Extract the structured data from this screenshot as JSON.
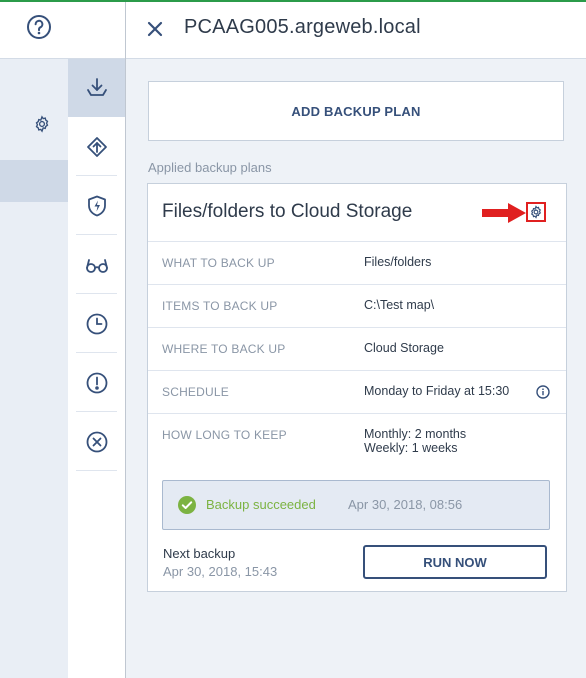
{
  "window": {
    "title": "PCAAG005.argeweb.local"
  },
  "left_strip": {
    "icons": {
      "help": "question-circle-icon",
      "account": "user-circle-icon",
      "settings": "gear-icon"
    }
  },
  "rail": {
    "items": [
      {
        "name": "backup",
        "icon": "download-icon",
        "active": true
      },
      {
        "name": "recovery",
        "icon": "upload-diamond-icon",
        "active": false
      },
      {
        "name": "protection",
        "icon": "shield-bolt-icon",
        "active": false
      },
      {
        "name": "monitoring",
        "icon": "glasses-icon",
        "active": false
      },
      {
        "name": "activities",
        "icon": "clock-icon",
        "active": false
      },
      {
        "name": "alerts",
        "icon": "exclamation-circle-icon",
        "active": false
      },
      {
        "name": "remove",
        "icon": "x-circle-icon",
        "active": false
      }
    ]
  },
  "actions": {
    "add_plan_label": "ADD BACKUP PLAN"
  },
  "applied_plans_label": "Applied backup plans",
  "plan": {
    "title": "Files/folders to Cloud Storage",
    "properties": [
      {
        "label": "WHAT TO BACK UP",
        "value": "Files/folders"
      },
      {
        "label": "ITEMS TO BACK UP",
        "value": "C:\\Test map\\"
      },
      {
        "label": "WHERE TO BACK UP",
        "value": "Cloud Storage"
      },
      {
        "label": "SCHEDULE",
        "value": "Monday to Friday at 15:30"
      },
      {
        "label": "HOW LONG TO KEEP",
        "value_line1": "Monthly: 2 months",
        "value_line2": "Weekly: 1 weeks"
      }
    ],
    "status": {
      "text": "Backup succeeded",
      "time": "Apr 30, 2018, 08:56"
    },
    "next_backup": {
      "label": "Next backup",
      "time": "Apr 30, 2018, 15:43"
    },
    "run_now_label": "RUN NOW"
  },
  "colors": {
    "accent": "#36507a",
    "success": "#7cb342",
    "highlight": "#e02020",
    "rail_active": "#cfd9e7"
  }
}
